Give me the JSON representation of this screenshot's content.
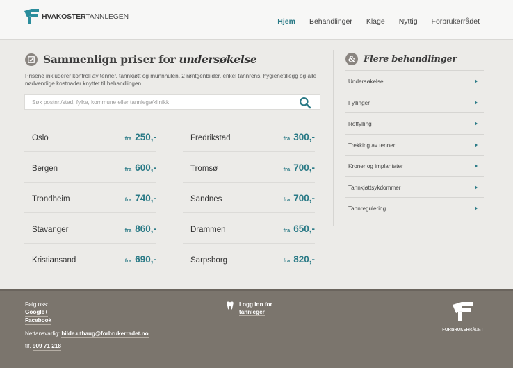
{
  "header": {
    "logo": {
      "bold": "HVAKOSTER",
      "light": "TANNLEGEN"
    },
    "nav": [
      {
        "label": "Hjem",
        "active": true
      },
      {
        "label": "Behandlinger",
        "active": false
      },
      {
        "label": "Klage",
        "active": false
      },
      {
        "label": "Nyttig",
        "active": false
      },
      {
        "label": "Forbrukerrådet",
        "active": false
      }
    ]
  },
  "main": {
    "title_prefix": "Sammenlign priser for ",
    "title_emphasis": "undersøkelse",
    "description": "Prisene inkluderer kontroll av tenner, tannkjøtt og munnhulen, 2 røntgenbilder, enkel tannrens, hygienetillegg og alle nødvendige kostnader knyttet til behandlingen.",
    "search": {
      "placeholder": "Søk postnr./sted, fylke, kommune eller tannlege/klinikk",
      "value": ""
    },
    "price_prefix": "fra",
    "cities_left": [
      {
        "name": "Oslo",
        "price": "250,-"
      },
      {
        "name": "Bergen",
        "price": "600,-"
      },
      {
        "name": "Trondheim",
        "price": "740,-"
      },
      {
        "name": "Stavanger",
        "price": "860,-"
      },
      {
        "name": "Kristiansand",
        "price": "690,-"
      }
    ],
    "cities_right": [
      {
        "name": "Fredrikstad",
        "price": "300,-"
      },
      {
        "name": "Tromsø",
        "price": "700,-"
      },
      {
        "name": "Sandnes",
        "price": "700,-"
      },
      {
        "name": "Drammen",
        "price": "650,-"
      },
      {
        "name": "Sarpsborg",
        "price": "820,-"
      }
    ]
  },
  "sidebar": {
    "icon_glyph": "&",
    "title": "Flere behandlinger",
    "items": [
      {
        "label": "Undersøkelse"
      },
      {
        "label": "Fyllinger"
      },
      {
        "label": "Rotfylling"
      },
      {
        "label": "Trekking av tenner"
      },
      {
        "label": "Kroner og implantater"
      },
      {
        "label": "Tannkjøttsykdommer"
      },
      {
        "label": "Tannregulering"
      }
    ]
  },
  "footer": {
    "follow_label": "Følg oss:",
    "google_plus": "Google+",
    "facebook": "Facebook",
    "webmaster_label": "Nettansvarlig: ",
    "webmaster_email": "hilde.uthaug@forbrukerradet.no",
    "phone_label": "tlf. ",
    "phone": "909 71 218",
    "login_line1": "Logg inn for",
    "login_line2": "tannleger",
    "brand_bold": "FORBRUKER",
    "brand_light": "RÅDET"
  },
  "colors": {
    "accent": "#2a7a86",
    "footer_bg": "#7b756d",
    "page_bg": "#ecebe8"
  }
}
